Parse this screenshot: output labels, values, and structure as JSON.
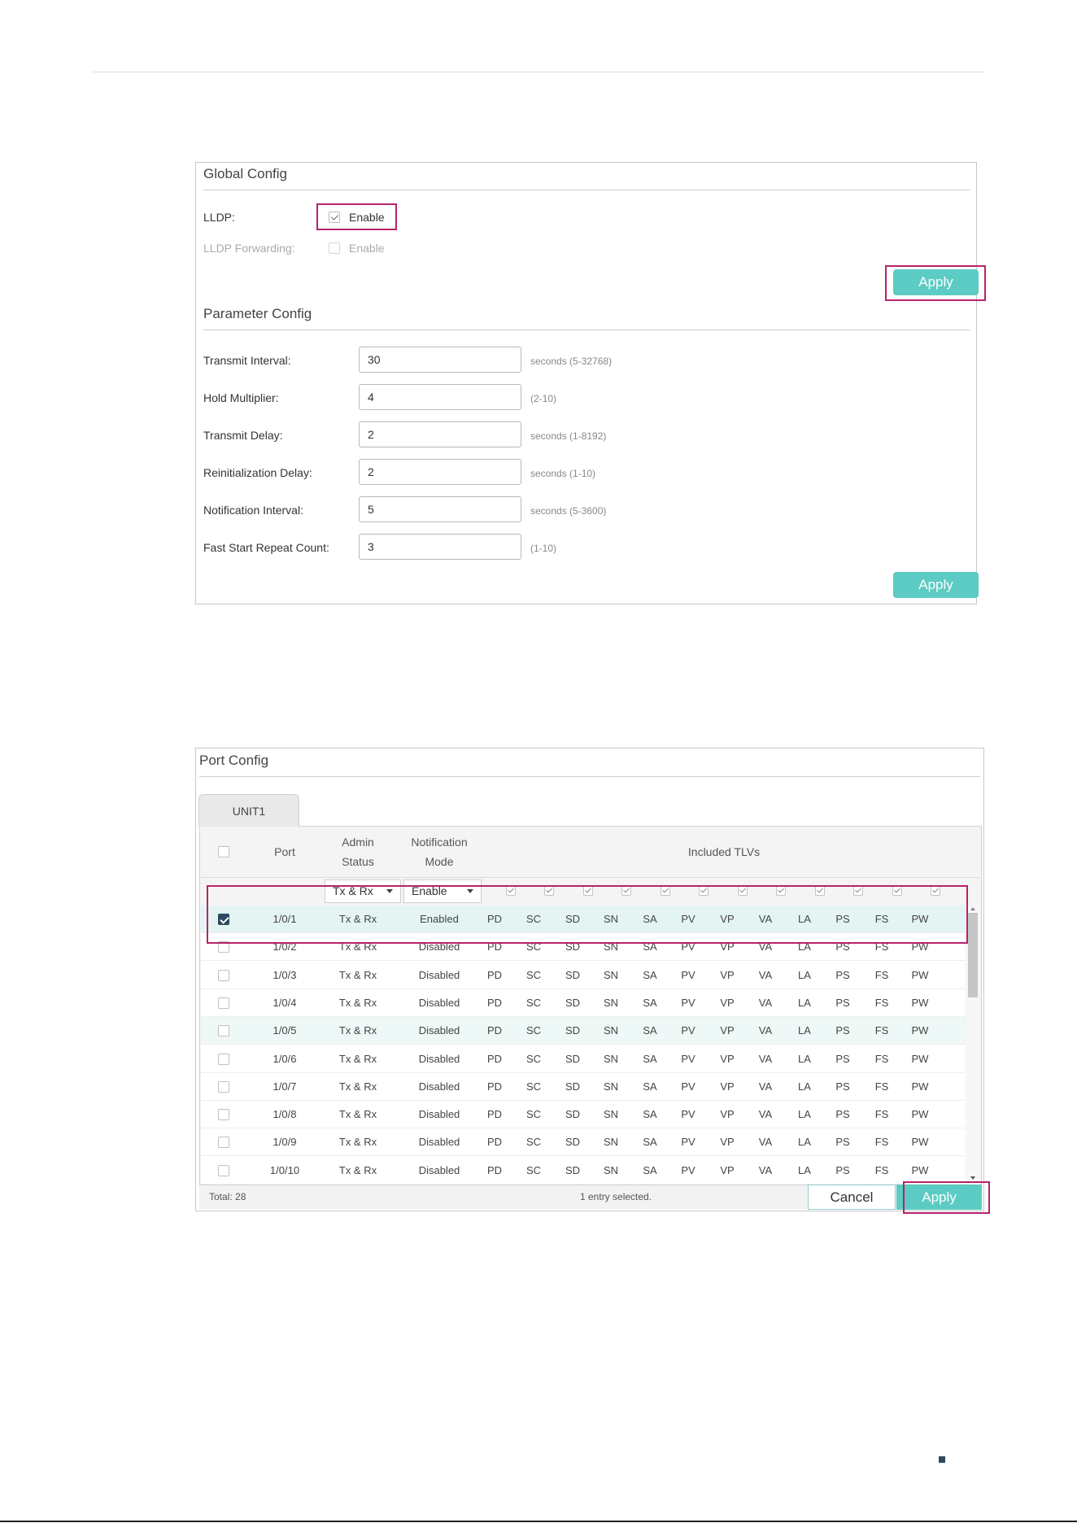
{
  "global_config": {
    "title": "Global Config",
    "lldp_label": "LLDP:",
    "lldp_enable": "Enable",
    "lldp_checked": true,
    "forwarding_label": "LLDP Forwarding:",
    "forwarding_enable": "Enable",
    "forwarding_checked": false,
    "apply_label": "Apply"
  },
  "parameter_config": {
    "title": "Parameter Config",
    "fields": [
      {
        "label": "Transmit Interval:",
        "value": "30",
        "hint": "seconds (5-32768)"
      },
      {
        "label": "Hold Multiplier:",
        "value": "4",
        "hint": "(2-10)"
      },
      {
        "label": "Transmit Delay:",
        "value": "2",
        "hint": "seconds (1-8192)"
      },
      {
        "label": "Reinitialization Delay:",
        "value": "2",
        "hint": "seconds (1-10)"
      },
      {
        "label": "Notification Interval:",
        "value": "5",
        "hint": "seconds (5-3600)"
      },
      {
        "label": "Fast Start Repeat Count:",
        "value": "3",
        "hint": "(1-10)"
      }
    ],
    "apply_label": "Apply"
  },
  "port_config": {
    "title": "Port Config",
    "tab": "UNIT1",
    "headers": {
      "port": "Port",
      "admin_status_1": "Admin",
      "admin_status_2": "Status",
      "notification_1": "Notification",
      "notification_2": "Mode",
      "included_tlvs": "Included TLVs"
    },
    "admin_status_select": "Tx & Rx",
    "notification_select": "Enable",
    "tlvs": [
      "PD",
      "SC",
      "SD",
      "SN",
      "SA",
      "PV",
      "VP",
      "VA",
      "LA",
      "PS",
      "FS",
      "PW"
    ],
    "rows": [
      {
        "port": "1/0/1",
        "admin": "Tx & Rx",
        "mode": "Enabled",
        "checked": true
      },
      {
        "port": "1/0/2",
        "admin": "Tx & Rx",
        "mode": "Disabled",
        "checked": false
      },
      {
        "port": "1/0/3",
        "admin": "Tx & Rx",
        "mode": "Disabled",
        "checked": false
      },
      {
        "port": "1/0/4",
        "admin": "Tx & Rx",
        "mode": "Disabled",
        "checked": false
      },
      {
        "port": "1/0/5",
        "admin": "Tx & Rx",
        "mode": "Disabled",
        "checked": false
      },
      {
        "port": "1/0/6",
        "admin": "Tx & Rx",
        "mode": "Disabled",
        "checked": false
      },
      {
        "port": "1/0/7",
        "admin": "Tx & Rx",
        "mode": "Disabled",
        "checked": false
      },
      {
        "port": "1/0/8",
        "admin": "Tx & Rx",
        "mode": "Disabled",
        "checked": false
      },
      {
        "port": "1/0/9",
        "admin": "Tx & Rx",
        "mode": "Disabled",
        "checked": false
      },
      {
        "port": "1/0/10",
        "admin": "Tx & Rx",
        "mode": "Disabled",
        "checked": false
      }
    ],
    "total": "Total: 28",
    "selection_status": "1 entry selected.",
    "cancel_label": "Cancel",
    "apply_label": "Apply"
  },
  "colors": {
    "accent": "#5ccbc3",
    "highlight": "#b5236b",
    "checkbox_dark": "#2d4a5e"
  }
}
